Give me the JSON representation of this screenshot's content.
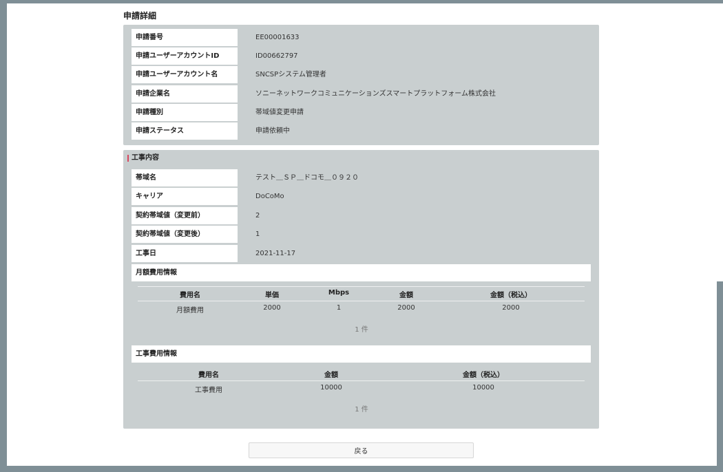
{
  "page": {
    "title": "申請詳細"
  },
  "application": {
    "rows": [
      {
        "label": "申請番号",
        "value": "EE00001633"
      },
      {
        "label": "申請ユーザーアカウントID",
        "value": "ID00662797"
      },
      {
        "label": "申請ユーザーアカウント名",
        "value": "SNCSPシステム管理者"
      },
      {
        "label": "申請企業名",
        "value": "ソニーネットワークコミュニケーションズスマートプラットフォーム株式会社"
      },
      {
        "label": "申請種別",
        "value": "帯域値変更申請"
      },
      {
        "label": "申請ステータス",
        "value": "申請依頼中"
      }
    ]
  },
  "work": {
    "section_title": "工事内容",
    "rows": [
      {
        "label": "帯域名",
        "value": "テスト＿ＳＰ＿ドコモ＿０９２０"
      },
      {
        "label": "キャリア",
        "value": "DoCoMo"
      },
      {
        "label": "契約帯域値（変更前）",
        "value": "2"
      },
      {
        "label": "契約帯域値（変更後）",
        "value": "1"
      },
      {
        "label": "工事日",
        "value": "2021-11-17"
      }
    ],
    "monthly": {
      "title": "月額費用情報",
      "headers": [
        "費用名",
        "単価",
        "Mbps",
        "金額",
        "金額（税込）"
      ],
      "rows": [
        [
          "月額費用",
          "2000",
          "1",
          "2000",
          "2000"
        ]
      ],
      "count": "1 件"
    },
    "construction": {
      "title": "工事費用情報",
      "headers": [
        "費用名",
        "金額",
        "金額（税込）"
      ],
      "rows": [
        [
          "工事費用",
          "10000",
          "10000"
        ]
      ],
      "count": "1 件"
    }
  },
  "actions": {
    "back_label": "戻る"
  }
}
